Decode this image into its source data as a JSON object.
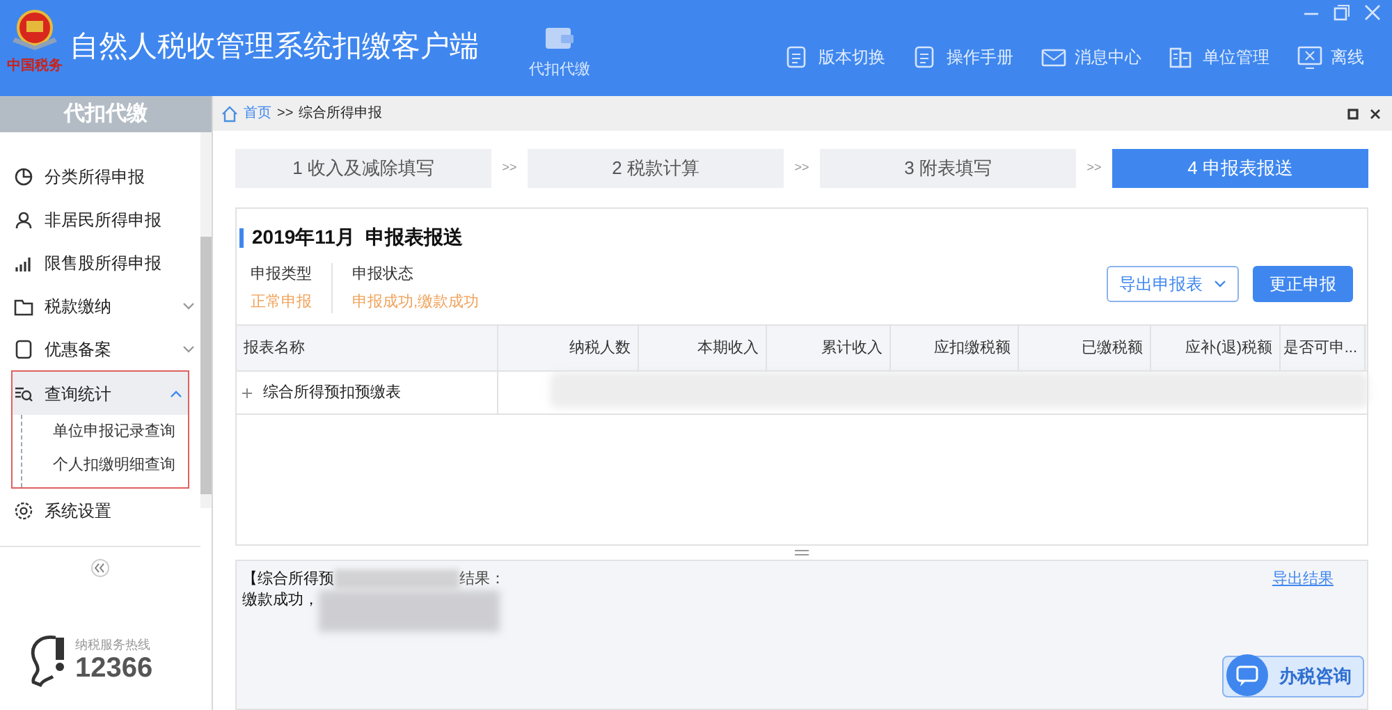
{
  "window": {
    "title": "自然人税收管理系统扣缴客户端",
    "logo_caption": "中国税务"
  },
  "header_nav": [
    {
      "label": "代扣代缴",
      "selected": true
    }
  ],
  "toolbar": [
    {
      "label": "版本切换",
      "kind": "doc"
    },
    {
      "label": "操作手册",
      "kind": "doc"
    },
    {
      "label": "消息中心",
      "kind": "mail"
    },
    {
      "label": "单位管理",
      "kind": "org"
    },
    {
      "label": "离线",
      "kind": "offline"
    }
  ],
  "sidebar": {
    "title": "代扣代缴",
    "items": [
      {
        "label": "分类所得申报",
        "kind": "pie"
      },
      {
        "label": "非居民所得申报",
        "kind": "person"
      },
      {
        "label": "限售股所得申报",
        "kind": "bars"
      },
      {
        "label": "税款缴纳",
        "kind": "folder",
        "expanded": false
      },
      {
        "label": "优惠备案",
        "kind": "page",
        "expanded": false
      },
      {
        "label": "查询统计",
        "kind": "search",
        "expanded": true,
        "highlighted": true,
        "children": [
          {
            "label": "单位申报记录查询"
          },
          {
            "label": "个人扣缴明细查询"
          }
        ]
      },
      {
        "label": "系统设置",
        "kind": "gear"
      }
    ],
    "hotline_label": "纳税服务热线",
    "hotline_number": "12366"
  },
  "breadcrumb": {
    "home": "首页",
    "separator": ">>",
    "current": "综合所得申报"
  },
  "steps": [
    {
      "label": "1 收入及减除填写",
      "selected": false
    },
    {
      "label": "2 税款计算",
      "selected": false
    },
    {
      "label": "3 附表填写",
      "selected": false
    },
    {
      "label": "4 申报表报送",
      "selected": true
    }
  ],
  "step_separator": ">>",
  "card": {
    "title": "2019年11月  申报表报送",
    "fields": [
      {
        "label": "申报类型",
        "value": "正常申报"
      },
      {
        "label": "申报状态",
        "value": "申报成功,缴款成功"
      }
    ],
    "export_button": "导出申报表",
    "correct_button": "更正申报",
    "table": {
      "columns": [
        "报表名称",
        "纳税人数",
        "本期收入",
        "累计收入",
        "应扣缴税额",
        "已缴税额",
        "应补(退)税额",
        "是否可申..."
      ],
      "rows": [
        {
          "name": "综合所得预扣预缴表",
          "expanded": false
        }
      ]
    }
  },
  "result": {
    "line_1_start": "【综合所得预",
    "line_1_end": "结果：",
    "line_2": "缴款成功，",
    "export_link": "导出结果"
  },
  "consult_button": "办税咨询"
}
